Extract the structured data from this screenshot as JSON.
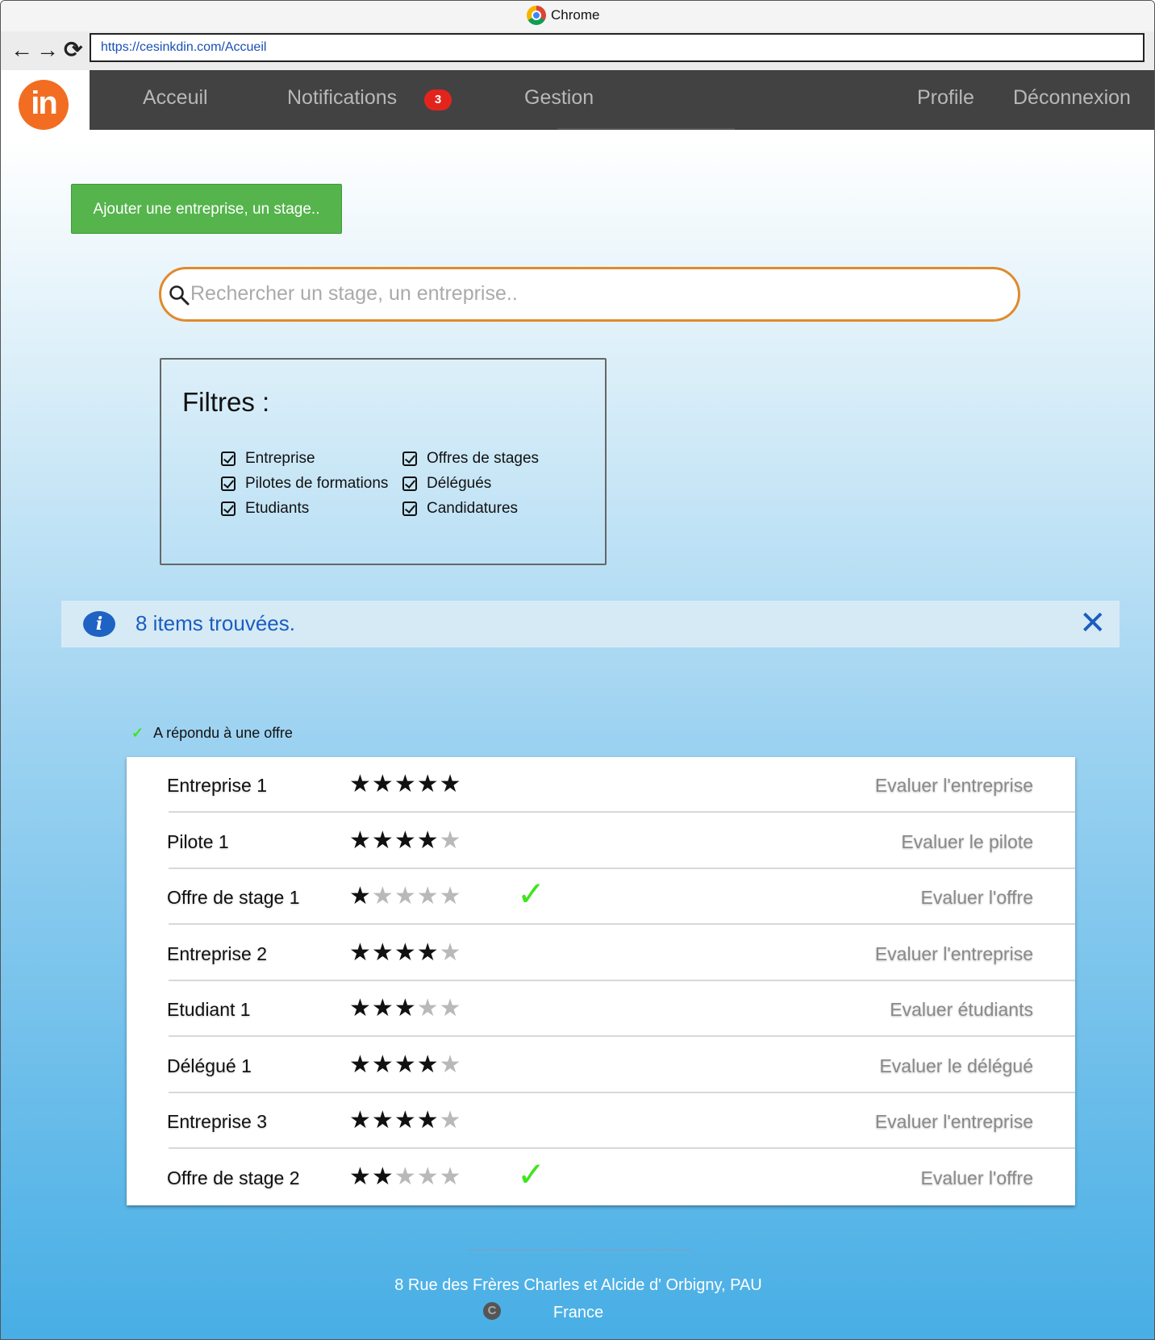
{
  "window": {
    "title": "Chrome",
    "url": "https://cesinkdin.com/Accueil"
  },
  "browser": {
    "back_icon": "arrow-left-icon",
    "forward_icon": "arrow-right-icon",
    "reload_icon": "reload-icon"
  },
  "nav": {
    "logo_text": "in",
    "items": {
      "home": "Acceuil",
      "notifications": "Notifications",
      "gestion": "Gestion",
      "profile": "Profile",
      "logout": "Déconnexion"
    },
    "notification_count": "3"
  },
  "main": {
    "add_button": "Ajouter une entreprise, un stage..",
    "search_placeholder": "Rechercher un stage, un entreprise.."
  },
  "filters": {
    "title": "Filtres :",
    "options": [
      {
        "label": "Entreprise",
        "checked": true
      },
      {
        "label": "Offres de stages",
        "checked": true
      },
      {
        "label": "Pilotes de formations",
        "checked": true
      },
      {
        "label": "Délégués",
        "checked": true
      },
      {
        "label": "Etudiants",
        "checked": true
      },
      {
        "label": "Candidatures",
        "checked": true
      }
    ]
  },
  "alert": {
    "text": "8 items trouvées.",
    "icon": "info-icon",
    "close_icon": "close-icon"
  },
  "legend": {
    "check": "✓",
    "text": "A répondu à une offre"
  },
  "results": [
    {
      "name": "Entreprise 1",
      "rating": 5,
      "answered": false,
      "action": "Evaluer l'entreprise"
    },
    {
      "name": "Pilote 1",
      "rating": 4,
      "answered": false,
      "action": "Evaluer le pilote"
    },
    {
      "name": "Offre de stage 1",
      "rating": 1,
      "answered": true,
      "action": "Evaluer l'offre"
    },
    {
      "name": "Entreprise 2",
      "rating": 4,
      "answered": false,
      "action": "Evaluer l'entreprise"
    },
    {
      "name": "Etudiant 1",
      "rating": 3,
      "answered": false,
      "action": "Evaluer étudiants"
    },
    {
      "name": "Délégué 1",
      "rating": 4,
      "answered": false,
      "action": "Evaluer le délégué"
    },
    {
      "name": "Entreprise 3",
      "rating": 4,
      "answered": false,
      "action": "Evaluer l'entreprise"
    },
    {
      "name": "Offre de stage 2",
      "rating": 2,
      "answered": true,
      "action": "Evaluer l'offre"
    }
  ],
  "rating_max": 5,
  "footer": {
    "address": "8 Rue des Frères Charles et Alcide d' Orbigny, PAU",
    "country": "France",
    "copyright_icon": "copyright-icon"
  },
  "colors": {
    "accent": "#f26d21",
    "nav_bg": "#424242",
    "button_green": "#55b44c",
    "search_border": "#e08a2c",
    "info_blue": "#1a5ec0",
    "check_green": "#3ee51c",
    "badge_red": "#e3241d"
  }
}
